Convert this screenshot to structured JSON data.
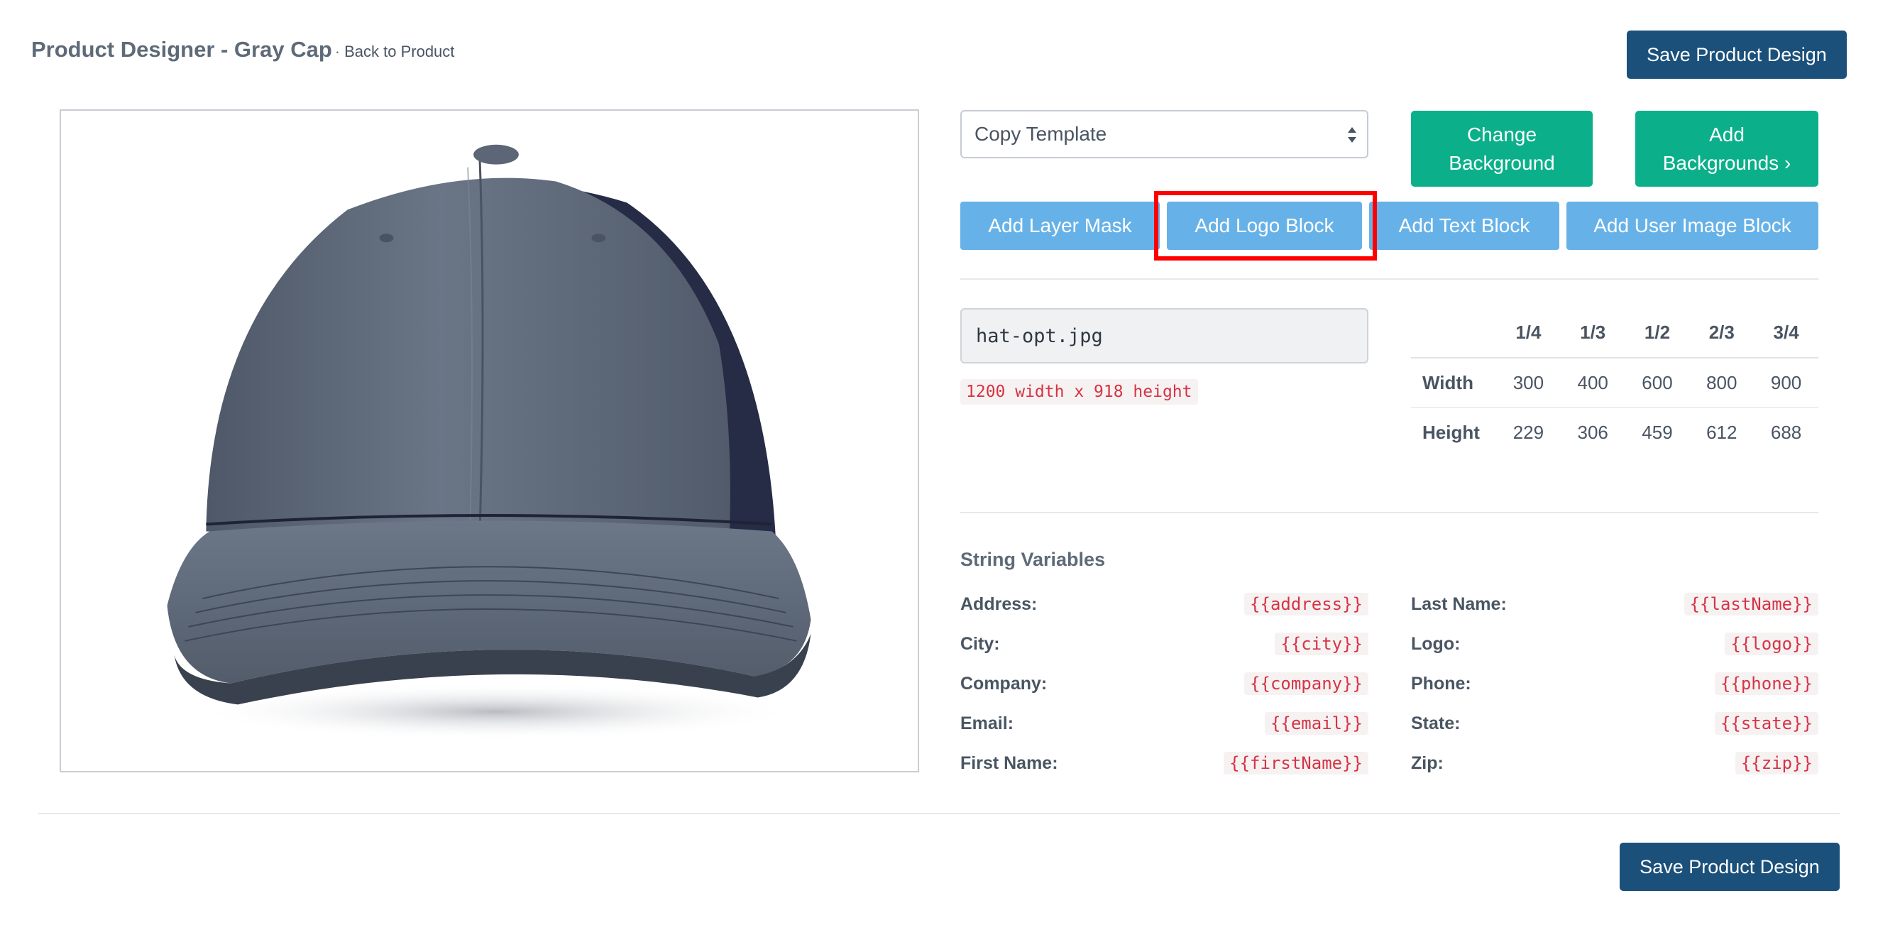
{
  "header": {
    "title": "Product Designer - Gray Cap",
    "separator": "·",
    "back_link": "Back to Product",
    "save_label": "Save Product Design"
  },
  "image": {
    "subject": "cap-image",
    "cap_color": "#5f6a79",
    "mesh_color": "#262c45"
  },
  "template_select": {
    "selected": "Copy Template"
  },
  "buttons": {
    "change_background": "Change Background",
    "add_backgrounds": "Add Backgrounds",
    "add_backgrounds_chevron": "›",
    "add_layer_mask": "Add Layer Mask",
    "add_logo_block": "Add Logo Block",
    "add_text_block": "Add Text Block",
    "add_user_image_block": "Add User Image Block"
  },
  "file": {
    "name": "hat-opt.jpg",
    "dimensions": "1200 width x 918 height"
  },
  "size_table": {
    "headers": [
      "",
      "1/4",
      "1/3",
      "1/2",
      "2/3",
      "3/4"
    ],
    "rows": [
      {
        "label": "Width",
        "values": [
          "300",
          "400",
          "600",
          "800",
          "900"
        ]
      },
      {
        "label": "Height",
        "values": [
          "229",
          "306",
          "459",
          "612",
          "688"
        ]
      }
    ]
  },
  "string_variables": {
    "title": "String Variables",
    "left": [
      {
        "label": "Address:",
        "code": "{{address}}"
      },
      {
        "label": "City:",
        "code": "{{city}}"
      },
      {
        "label": "Company:",
        "code": "{{company}}"
      },
      {
        "label": "Email:",
        "code": "{{email}}"
      },
      {
        "label": "First Name:",
        "code": "{{firstName}}"
      }
    ],
    "right": [
      {
        "label": "Last Name:",
        "code": "{{lastName}}"
      },
      {
        "label": "Logo:",
        "code": "{{logo}}"
      },
      {
        "label": "Phone:",
        "code": "{{phone}}"
      },
      {
        "label": "State:",
        "code": "{{state}}"
      },
      {
        "label": "Zip:",
        "code": "{{zip}}"
      }
    ]
  },
  "colors": {
    "primary_dark": "#1b507a",
    "green": "#0bb08a",
    "light_blue": "#66b2e8",
    "highlight": "#ff0000",
    "code_red": "#d63345"
  }
}
